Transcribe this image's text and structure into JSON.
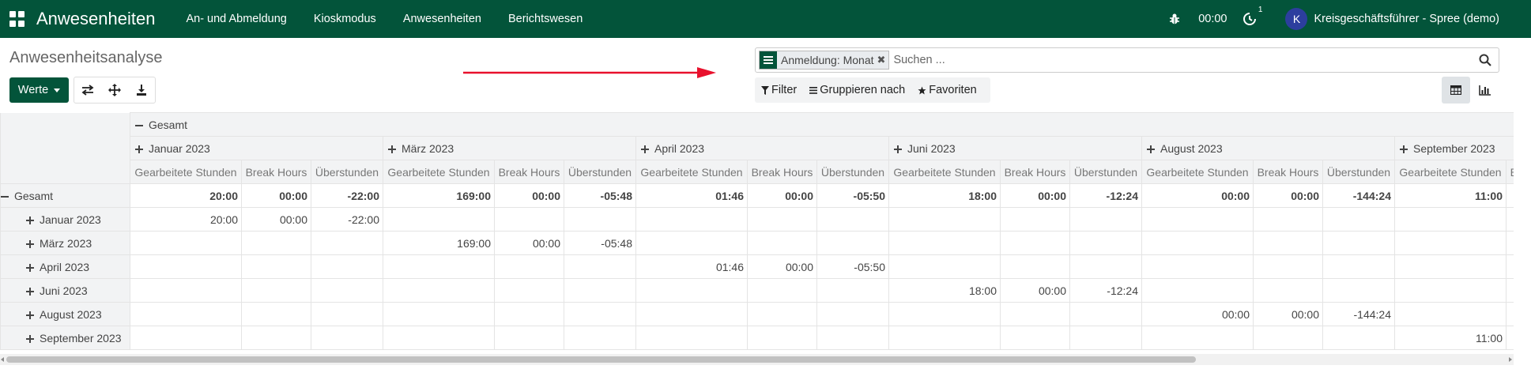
{
  "navbar": {
    "brand": "Anwesenheiten",
    "menu": [
      "An- und Abmeldung",
      "Kioskmodus",
      "Anwesenheiten",
      "Berichtswesen"
    ],
    "timer": "00:00",
    "activity_count": "1",
    "user_initial": "K",
    "user_name": "Kreisgeschäftsführer - Spree (demo)",
    "color": "#03543a"
  },
  "control": {
    "title": "Anwesenheitsanalyse",
    "measures_button": "Werte",
    "search": {
      "facet": "Anmeldung: Monat",
      "placeholder": "Suchen ..."
    },
    "filter_label": "Filter",
    "groupby_label": "Gruppieren nach",
    "favorites_label": "Favoriten",
    "annotation_arrow_color": "#e8112d"
  },
  "pivot": {
    "total_label": "Gesamt",
    "columns": [
      "Januar 2023",
      "März 2023",
      "April 2023",
      "Juni 2023",
      "August 2023",
      "September 2023"
    ],
    "measures": [
      "Gearbeitete Stunden",
      "Break Hours",
      "Überstunden"
    ],
    "overflow_measure_initial": "B",
    "total_row": [
      [
        "20:00",
        "00:00",
        "-22:00"
      ],
      [
        "169:00",
        "00:00",
        "-05:48"
      ],
      [
        "01:46",
        "00:00",
        "-05:50"
      ],
      [
        "18:00",
        "00:00",
        "-12:24"
      ],
      [
        "00:00",
        "00:00",
        "-144:24"
      ],
      [
        "11:00"
      ]
    ],
    "rows": [
      {
        "label": "Januar 2023",
        "col": 0,
        "values": [
          "20:00",
          "00:00",
          "-22:00"
        ]
      },
      {
        "label": "März 2023",
        "col": 1,
        "values": [
          "169:00",
          "00:00",
          "-05:48"
        ]
      },
      {
        "label": "April 2023",
        "col": 2,
        "values": [
          "01:46",
          "00:00",
          "-05:50"
        ]
      },
      {
        "label": "Juni 2023",
        "col": 3,
        "values": [
          "18:00",
          "00:00",
          "-12:24"
        ]
      },
      {
        "label": "August 2023",
        "col": 4,
        "values": [
          "00:00",
          "00:00",
          "-144:24"
        ]
      },
      {
        "label": "September 2023",
        "col": 5,
        "values": [
          "11:00"
        ]
      }
    ]
  }
}
